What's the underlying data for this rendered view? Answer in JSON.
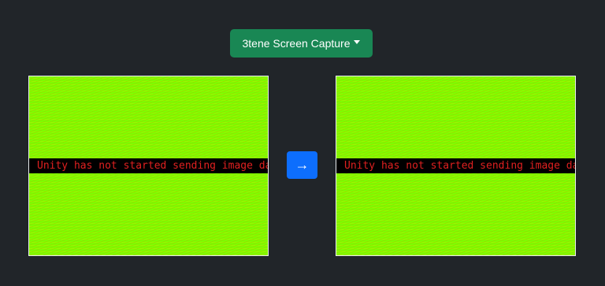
{
  "source_dropdown": {
    "label": "3tene Screen Capture"
  },
  "left_preview": {
    "banner_text": "Unity has not started sending image data (Ca"
  },
  "right_preview": {
    "banner_text": "Unity has not started sending image data (Ca"
  },
  "arrow_button": {
    "symbol": "→"
  },
  "colors": {
    "background": "#212529",
    "dropdown": "#198754",
    "arrow_button": "#0d6efd",
    "preview_fill": "#7dff00",
    "banner_text": "#e02020"
  }
}
